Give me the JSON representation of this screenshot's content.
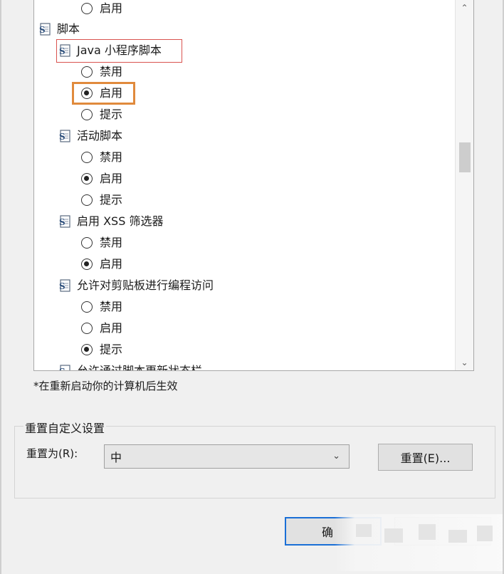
{
  "list": {
    "top_partial": {
      "option": "启用",
      "checked": false
    },
    "category": {
      "label": "脚本"
    },
    "groups": [
      {
        "label": "Java 小程序脚本",
        "options": [
          {
            "label": "禁用",
            "checked": false
          },
          {
            "label": "启用",
            "checked": true
          },
          {
            "label": "提示",
            "checked": false
          }
        ]
      },
      {
        "label": "活动脚本",
        "options": [
          {
            "label": "禁用",
            "checked": false
          },
          {
            "label": "启用",
            "checked": true
          },
          {
            "label": "提示",
            "checked": false
          }
        ]
      },
      {
        "label": "启用 XSS 筛选器",
        "options": [
          {
            "label": "禁用",
            "checked": false
          },
          {
            "label": "启用",
            "checked": true
          }
        ]
      },
      {
        "label": "允许对剪贴板进行编程访问",
        "options": [
          {
            "label": "禁用",
            "checked": false
          },
          {
            "label": "启用",
            "checked": false
          },
          {
            "label": "提示",
            "checked": true
          }
        ]
      }
    ],
    "bottom_partial": {
      "label": "允许通过脚本更新状态栏"
    }
  },
  "footnote": "*在重新启动你的计算机后生效",
  "reset_group": {
    "title": "重置自定义设置",
    "label": "重置为(R):",
    "selected": "中",
    "button": "重置(E)..."
  },
  "dialog_buttons": {
    "ok": "确"
  },
  "colors": {
    "highlight_red": "#d9534f",
    "highlight_orange": "#e08a3c",
    "ok_border": "#1a6fd6"
  },
  "icons": {
    "script": "script-settings-icon",
    "radio": "radio-button",
    "scroll_up": "chevron-up-icon",
    "scroll_down": "chevron-down-icon",
    "dropdown": "chevron-down-icon"
  }
}
